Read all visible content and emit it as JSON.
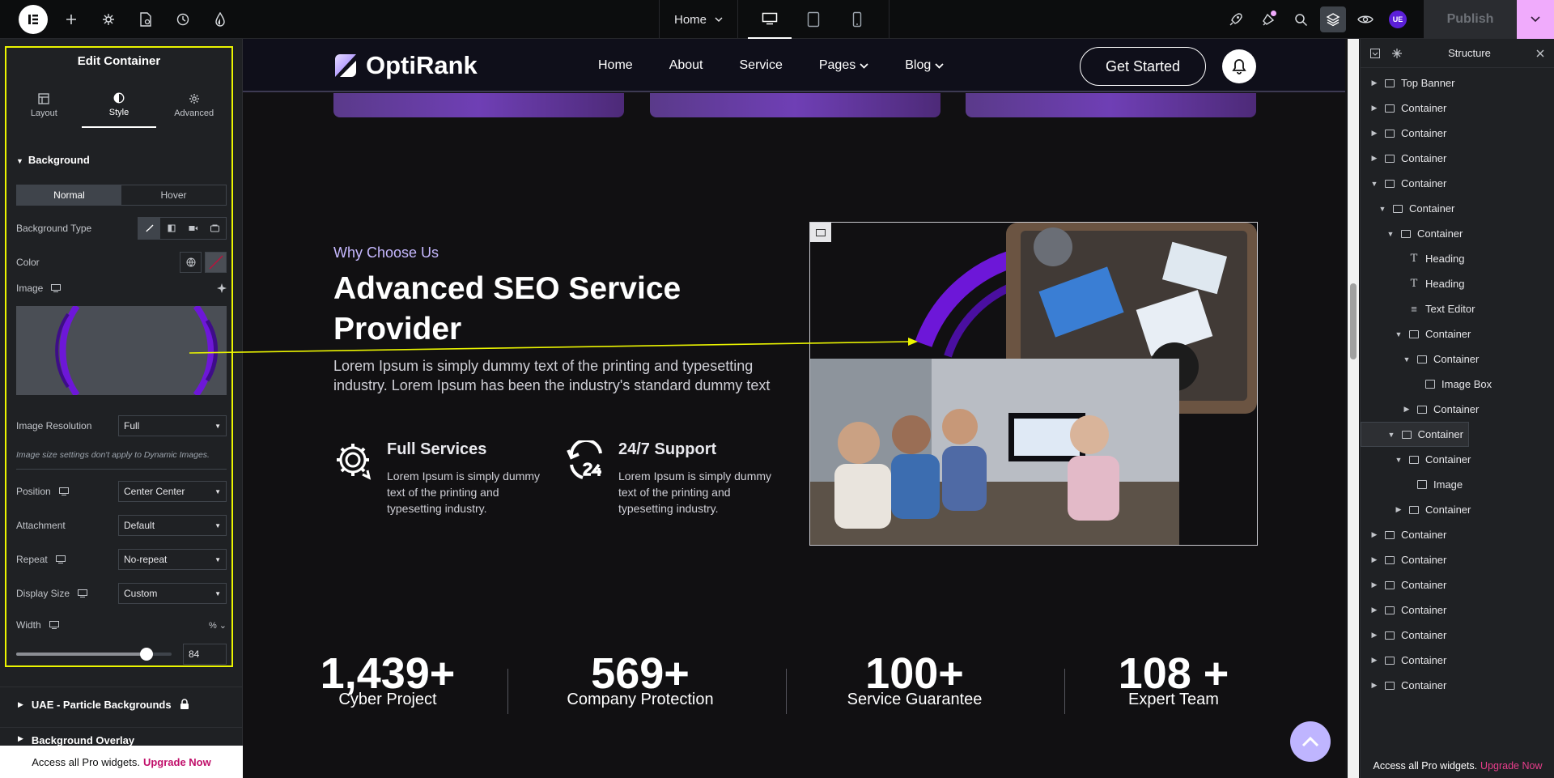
{
  "topbar": {
    "page_selector": "Home",
    "publish_label": "Publish",
    "avatar_initials": "UE"
  },
  "edit_panel": {
    "title": "Edit Container",
    "tabs": [
      {
        "label": "Layout",
        "icon": "layout-icon"
      },
      {
        "label": "Style",
        "icon": "half-circle-icon"
      },
      {
        "label": "Advanced",
        "icon": "gear-icon"
      }
    ],
    "section_title": "Background",
    "state_tabs": {
      "normal": "Normal",
      "hover": "Hover"
    },
    "background_type_label": "Background Type",
    "color_label": "Color",
    "image_label": "Image",
    "image_resolution_label": "Image Resolution",
    "image_resolution_value": "Full",
    "image_note": "Image size settings don't apply to Dynamic Images.",
    "position_label": "Position",
    "position_value": "Center Center",
    "attachment_label": "Attachment",
    "attachment_value": "Default",
    "repeat_label": "Repeat",
    "repeat_value": "No-repeat",
    "display_size_label": "Display Size",
    "display_size_value": "Custom",
    "width_label": "Width",
    "width_unit": "%",
    "width_value": "84",
    "width_fraction": 0.84,
    "collapsed_sections": [
      "UAE - Particle Backgrounds",
      "Background Overlay"
    ],
    "pro_text": "Access all Pro widgets.",
    "pro_link": "Upgrade Now",
    "highlight_color": "#ebf500"
  },
  "site": {
    "brand": "OptiRank",
    "nav": [
      "Home",
      "About",
      "Service",
      "Pages",
      "Blog"
    ],
    "cta": "Get Started",
    "eyebrow": "Why Choose Us",
    "heading": "Advanced SEO Service Provider",
    "lead": "Lorem Ipsum is simply dummy text of the printing and typesetting industry. Lorem Ipsum has been the industry's standard dummy text",
    "features": [
      {
        "title": "Full Services",
        "desc": "Lorem Ipsum is simply dummy text of the printing and typesetting industry.",
        "icon": "gear-arrows-icon"
      },
      {
        "title": "24/7 Support",
        "desc": "Lorem Ipsum is simply dummy text of the printing and typesetting industry.",
        "icon": "support-24-icon"
      }
    ],
    "stats": [
      {
        "num": "1,439+",
        "cap": "Cyber Project"
      },
      {
        "num": "569+",
        "cap": "Company Protection"
      },
      {
        "num": "100+",
        "cap": "Service Guarantee"
      },
      {
        "num": "108 +",
        "cap": "Expert Team"
      }
    ],
    "accent": "#6f3fb5"
  },
  "structure": {
    "title": "Structure",
    "nodes": [
      {
        "label": "Top Banner",
        "depth": 0,
        "caret": "right",
        "icon": "container"
      },
      {
        "label": "Container",
        "depth": 0,
        "caret": "right",
        "icon": "container"
      },
      {
        "label": "Container",
        "depth": 0,
        "caret": "right",
        "icon": "container"
      },
      {
        "label": "Container",
        "depth": 0,
        "caret": "right",
        "icon": "container"
      },
      {
        "label": "Container",
        "depth": 0,
        "caret": "down",
        "icon": "container"
      },
      {
        "label": "Container",
        "depth": 1,
        "caret": "down",
        "icon": "container"
      },
      {
        "label": "Container",
        "depth": 2,
        "caret": "down",
        "icon": "container"
      },
      {
        "label": "Heading",
        "depth": 3,
        "caret": "",
        "icon": "heading"
      },
      {
        "label": "Heading",
        "depth": 3,
        "caret": "",
        "icon": "heading"
      },
      {
        "label": "Text Editor",
        "depth": 3,
        "caret": "",
        "icon": "text"
      },
      {
        "label": "Container",
        "depth": 3,
        "caret": "down",
        "icon": "container"
      },
      {
        "label": "Container",
        "depth": 4,
        "caret": "down",
        "icon": "container"
      },
      {
        "label": "Image Box",
        "depth": 5,
        "caret": "",
        "icon": "image"
      },
      {
        "label": "Container",
        "depth": 4,
        "caret": "right",
        "icon": "container"
      },
      {
        "label": "Container",
        "depth": 2,
        "caret": "down",
        "icon": "container",
        "selected": true
      },
      {
        "label": "Container",
        "depth": 3,
        "caret": "down",
        "icon": "container"
      },
      {
        "label": "Image",
        "depth": 4,
        "caret": "",
        "icon": "image"
      },
      {
        "label": "Container",
        "depth": 3,
        "caret": "right",
        "icon": "container"
      },
      {
        "label": "Container",
        "depth": 0,
        "caret": "right",
        "icon": "container"
      },
      {
        "label": "Container",
        "depth": 0,
        "caret": "right",
        "icon": "container"
      },
      {
        "label": "Container",
        "depth": 0,
        "caret": "right",
        "icon": "container"
      },
      {
        "label": "Container",
        "depth": 0,
        "caret": "right",
        "icon": "container"
      },
      {
        "label": "Container",
        "depth": 0,
        "caret": "right",
        "icon": "container"
      },
      {
        "label": "Container",
        "depth": 0,
        "caret": "right",
        "icon": "container"
      },
      {
        "label": "Container",
        "depth": 0,
        "caret": "right",
        "icon": "container"
      }
    ],
    "pro_text": "Access all Pro widgets.",
    "pro_link": "Upgrade Now"
  }
}
